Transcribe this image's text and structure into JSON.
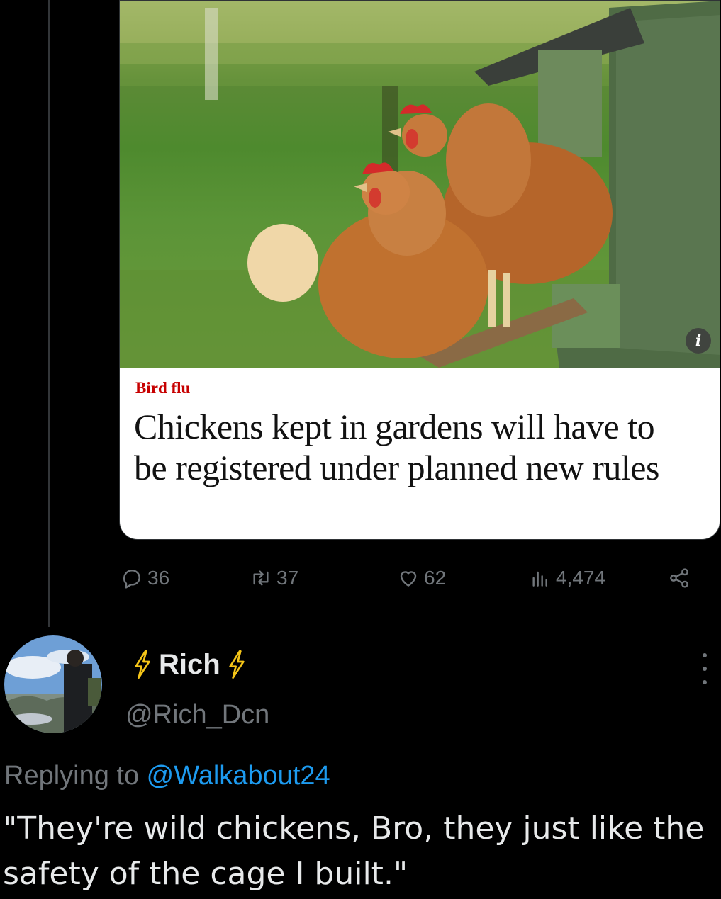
{
  "quoted_media": {
    "image_alt": "Two brown hens perched at a green wooden coop",
    "info_badge": "i",
    "kicker": "Bird flu",
    "headline": "Chickens kept in gardens will have to be registered under planned new rules",
    "colors": {
      "kicker": "#c70000",
      "headline": "#121212"
    }
  },
  "actions": {
    "replies": "36",
    "reposts": "37",
    "likes": "62",
    "views": "4,474",
    "icons": [
      "reply-icon",
      "repost-icon",
      "like-icon",
      "views-icon",
      "share-icon"
    ]
  },
  "reply": {
    "display_name": "Rich",
    "handle": "@Rich_Dcn",
    "replying_prefix": "Replying to ",
    "replying_mention": "@Walkabout24",
    "text": "\"They're wild chickens, Bro, they just like the safety of the cage I built.\"",
    "colors": {
      "accent": "#1d9bf0",
      "muted": "#71767b",
      "bolt": "#f5c518"
    }
  }
}
